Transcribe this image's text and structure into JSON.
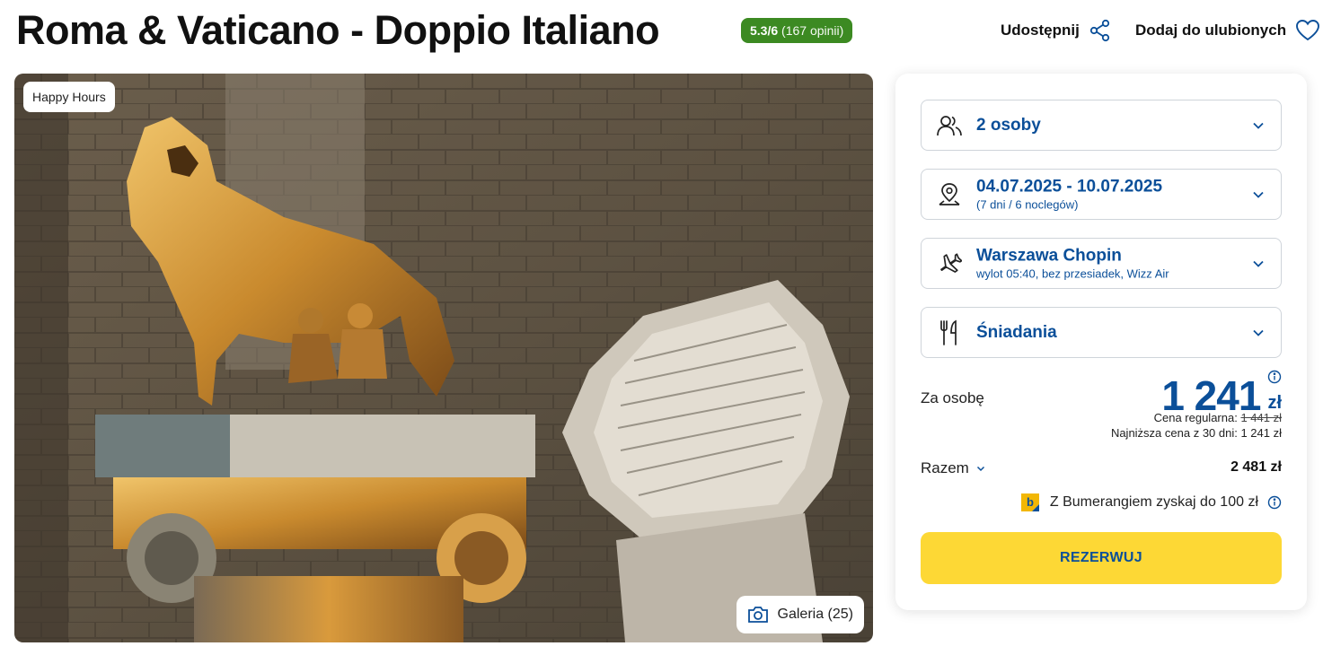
{
  "header": {
    "title": "Roma & Vaticano - Doppio Italiano",
    "rating_score": "5.3/6",
    "rating_count": "(167 opinii)",
    "share_label": "Udostępnij",
    "favorite_label": "Dodaj do ulubionych"
  },
  "photo": {
    "badge": "Happy Hours",
    "gallery_label": "Galeria (25)"
  },
  "booking": {
    "persons": "2 osoby",
    "dates": "04.07.2025 - 10.07.2025",
    "dates_sub": "(7 dni / 6 noclegów)",
    "departure": "Warszawa Chopin",
    "departure_sub": "wylot 05:40, bez przesiadek, Wizz Air",
    "board": "Śniadania",
    "per_person_label": "Za osobę",
    "price": "1 241",
    "currency": "zł",
    "regular_label": "Cena regularna:",
    "regular_price": "1 441 zł",
    "lowest_label": "Najniższa cena z 30 dni: 1 241 zł",
    "total_label": "Razem",
    "total_value": "2 481 zł",
    "bumerang_text": "Z Bumerangiem zyskaj do 100 zł",
    "reserve_label": "REZERWUJ"
  },
  "colors": {
    "brand_blue": "#0b4f99",
    "rating_green": "#3c8a22",
    "cta_yellow": "#fdd835"
  }
}
